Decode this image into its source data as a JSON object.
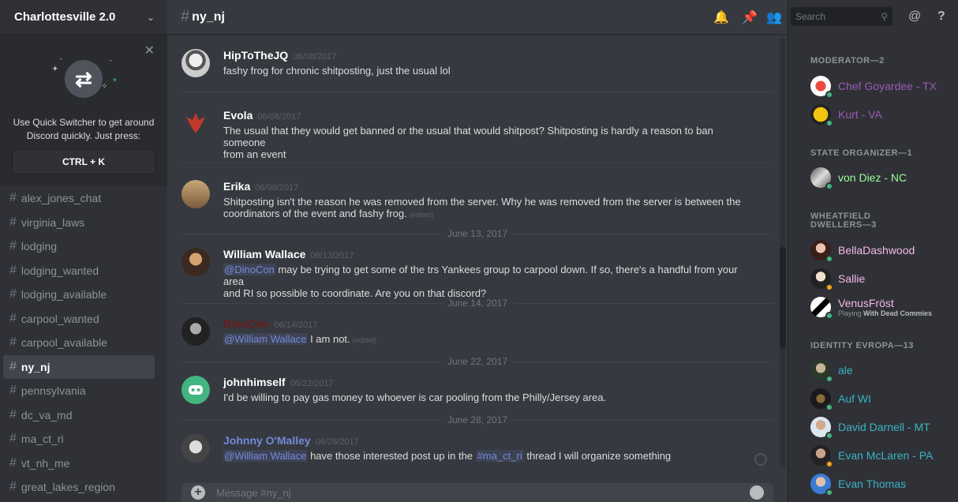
{
  "guild": {
    "name": "Charlottesville 2.0"
  },
  "quick_switcher": {
    "text_line1": "Use Quick Switcher to get around",
    "text_line2": "Discord quickly. Just press:",
    "shortcut": "CTRL + K"
  },
  "channels": [
    {
      "name": "alex_jones_chat",
      "active": false
    },
    {
      "name": "virginia_laws",
      "active": false
    },
    {
      "name": "lodging",
      "active": false
    },
    {
      "name": "lodging_wanted",
      "active": false
    },
    {
      "name": "lodging_available",
      "active": false
    },
    {
      "name": "carpool_wanted",
      "active": false
    },
    {
      "name": "carpool_available",
      "active": false
    },
    {
      "name": "ny_nj",
      "active": true
    },
    {
      "name": "pennsylvania",
      "active": false
    },
    {
      "name": "dc_va_md",
      "active": false
    },
    {
      "name": "ma_ct_ri",
      "active": false
    },
    {
      "name": "vt_nh_me",
      "active": false
    },
    {
      "name": "great_lakes_region",
      "active": false
    }
  ],
  "header": {
    "channel": "ny_nj",
    "search_placeholder": "Search"
  },
  "messages": [
    {
      "author": "HipToTheJQ",
      "timestamp": "06/08/2017",
      "lines": [
        "fashy frog for chronic shitposting, just the usual lol"
      ]
    },
    {
      "author": "Evola",
      "timestamp": "06/08/2017",
      "lines": [
        "The usual  that they would get banned or the usual that would shitpost? Shitposting is hardly a reason to ban someone",
        "from an event"
      ]
    },
    {
      "author": "Erika",
      "timestamp": "06/08/2017",
      "lines": [
        "Shitposting isn't the reason he was removed from the server. Why he was removed from the server is between the",
        "coordinators of the event and fashy frog."
      ],
      "edited": "(edited)"
    },
    {
      "author": "William Wallace",
      "timestamp": "06/13/2017",
      "mention": "@DinoCon",
      "lines": [
        " may be trying to get some of the trs Yankees group to carpool down. If so, there's a handful from your area",
        "and RI so possible to coordinate. Are you on that discord?"
      ]
    },
    {
      "author": "DinoCon",
      "timestamp": "06/14/2017",
      "mention": "@William Wallace",
      "lines": [
        "  I am not."
      ],
      "edited": "(edited)"
    },
    {
      "author": "johnhimself",
      "timestamp": "06/22/2017",
      "lines": [
        "I'd be willing to pay gas money to whoever is car pooling from the Philly/Jersey area."
      ]
    },
    {
      "author": "Johnny O'Malley",
      "timestamp": "06/28/2017",
      "mention": "@William Wallace",
      "lines": [
        " have those interested post up in the ",
        " thread I will organize something"
      ],
      "channel_mention": "#ma_ct_ri"
    }
  ],
  "date_dividers": [
    "June 13, 2017",
    "June 14, 2017",
    "June 22, 2017",
    "June 28, 2017"
  ],
  "composer": {
    "placeholder": "Message #ny_nj"
  },
  "member_groups": [
    {
      "title": "MODERATOR—2",
      "members": [
        {
          "name": "Chef Goyardee - TX",
          "color": "#9b59b6"
        },
        {
          "name": "Kurt - VA",
          "color": "#9b59b6"
        }
      ]
    },
    {
      "title": "STATE ORGANIZER—1",
      "members": [
        {
          "name": "von Diez - NC",
          "color": "#9cfc9c"
        }
      ]
    },
    {
      "title_line1": "WHEATFIELD",
      "title_line2": "DWELLERS—3",
      "members": [
        {
          "name": "BellaDashwood",
          "color": "#f5b8e8"
        },
        {
          "name": "Sallie",
          "color": "#f5b8e8"
        },
        {
          "name": "VenusFröst",
          "color": "#f5b8e8",
          "playing_prefix": "Playing",
          "playing_game": "With Dead Commies"
        }
      ]
    },
    {
      "title": "IDENTITY EVROPA—13",
      "members": [
        {
          "name": "ale",
          "color": "#3db2c4"
        },
        {
          "name": "Auf WI",
          "color": "#3db2c4"
        },
        {
          "name": "David Darnell - MT",
          "color": "#3db2c4"
        },
        {
          "name": "Evan McLaren - PA",
          "color": "#3db2c4"
        },
        {
          "name": "Evan Thomas",
          "color": "#3db2c4"
        }
      ]
    }
  ],
  "colors": {
    "accent": "#7289da",
    "online": "#43b581",
    "idle": "#faa61a",
    "dinocon": "#6d1a1a"
  }
}
